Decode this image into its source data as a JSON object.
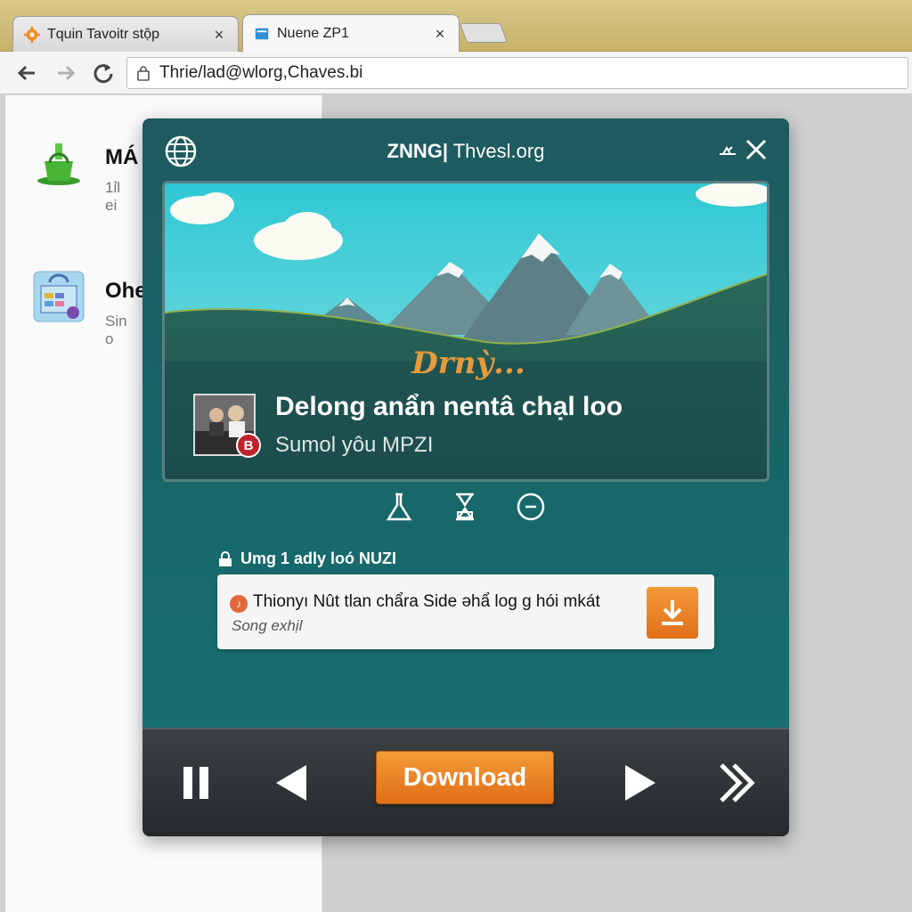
{
  "browser": {
    "tabs": [
      {
        "title": "Tquin Tavoitr stộp",
        "active": false,
        "favicon": "gear-orange-icon"
      },
      {
        "title": "Nuene ZP1",
        "active": true,
        "favicon": "page-blue-icon"
      }
    ],
    "url": "Thrie/lad@wlorg,Chaves.bi"
  },
  "background_page": {
    "items": [
      {
        "title": "MÁ",
        "subtitle": "1ỉl ei",
        "icon": "green-bag-icon"
      },
      {
        "title": "Ohe",
        "subtitle": "Sin o",
        "icon": "shopping-bag-icon"
      }
    ]
  },
  "player": {
    "brand": "ZNNG|",
    "site": " Thvesl.org",
    "hero_text": "Drnỳ...",
    "song": {
      "title": "Delong anẩn nentâ chạl loo",
      "subtitle": "Sumol yôu MPZI",
      "badge": "B"
    },
    "section_label": "Umg 1 adly loó NUZI",
    "file": {
      "name": "Thionyı Nût tlan chẩra Side ǝhẩ log g hói mkát",
      "subtitle": "Song exhịl"
    },
    "download_label": "Download",
    "colors": {
      "accent": "#e98a2c",
      "panel": "#17696b",
      "controls": "#2e3336"
    }
  }
}
